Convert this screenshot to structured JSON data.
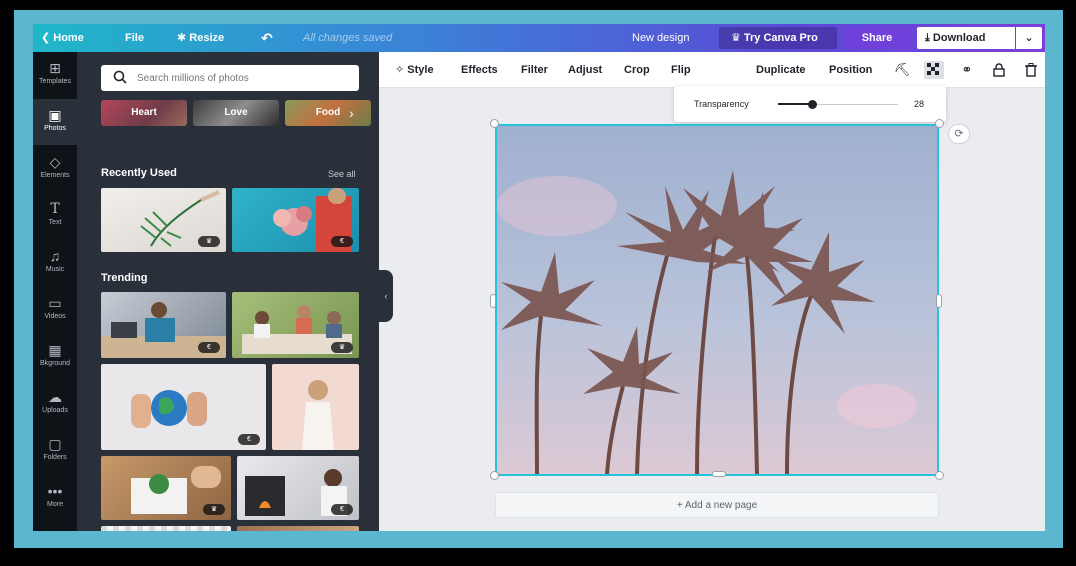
{
  "topbar": {
    "home": "❮  Home",
    "file": "File",
    "resize": "✱ Resize",
    "undo_icon": "undo-icon",
    "saved_status": "All changes saved",
    "design_name": "New design",
    "try_pro": "♛ Try Canva Pro",
    "share": "Share",
    "download": "⤓  Download",
    "download_menu": "⌄"
  },
  "rail": {
    "items": [
      {
        "label": "Templates",
        "icon": "templates-icon"
      },
      {
        "label": "Photos",
        "icon": "photos-icon"
      },
      {
        "label": "Elements",
        "icon": "elements-icon"
      },
      {
        "label": "Text",
        "icon": "text-icon"
      },
      {
        "label": "Music",
        "icon": "music-icon"
      },
      {
        "label": "Videos",
        "icon": "videos-icon"
      },
      {
        "label": "Bkground",
        "icon": "background-icon"
      },
      {
        "label": "Uploads",
        "icon": "uploads-icon"
      },
      {
        "label": "Folders",
        "icon": "folders-icon"
      },
      {
        "label": "More",
        "icon": "more-icon"
      }
    ],
    "active": "Photos"
  },
  "panel": {
    "search_placeholder": "Search millions of photos",
    "chips": [
      "Heart",
      "Love",
      "Food"
    ],
    "recent_title": "Recently Used",
    "see_all": "See all",
    "trending_title": "Trending",
    "badges": {
      "crown": "♛",
      "paid": "€"
    }
  },
  "toolbar": {
    "style": "✧ Style",
    "effects": "Effects",
    "filter": "Filter",
    "adjust": "Adjust",
    "crop": "Crop",
    "flip": "Flip",
    "duplicate": "Duplicate",
    "position": "Position",
    "icons": [
      "paint-roller-icon",
      "transparency-icon",
      "link-icon",
      "lock-icon",
      "trash-icon"
    ]
  },
  "transparency": {
    "label": "Transparency",
    "value": 28
  },
  "canvas": {
    "add_page": "+ Add a new page"
  },
  "colors": {
    "accent": "#27c3d9",
    "panel": "#293039",
    "rail": "#0e1318"
  }
}
